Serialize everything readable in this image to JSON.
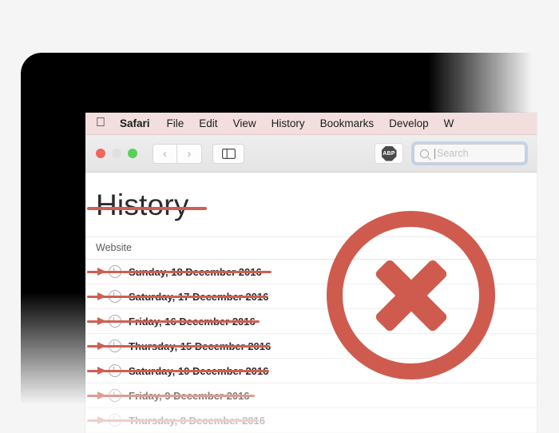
{
  "app": {
    "name": "Safari",
    "apple_logo_icon": "apple-logo-icon",
    "menus": [
      "Safari",
      "File",
      "Edit",
      "View",
      "History",
      "Bookmarks",
      "Develop",
      "W"
    ]
  },
  "toolbar": {
    "close_label": "",
    "minimize_label": "",
    "zoom_label": "",
    "back_icon": "‹",
    "forward_icon": "›",
    "sidebar_icon": "sidebar-toggle-icon",
    "extension_label": "ABP",
    "search": {
      "placeholder": "Search",
      "value": ""
    }
  },
  "page": {
    "title": "History",
    "struck_through": true,
    "columns": [
      "Website"
    ],
    "rows": [
      {
        "label": "Sunday, 18 December 2016",
        "struck": true,
        "fade": "none"
      },
      {
        "label": "Saturday, 17 December 2016",
        "struck": true,
        "fade": "none"
      },
      {
        "label": "Friday, 16 December 2016",
        "struck": true,
        "fade": "none"
      },
      {
        "label": "Thursday, 15 December 2016",
        "struck": true,
        "fade": "none"
      },
      {
        "label": "Saturday, 10 December 2016",
        "struck": true,
        "fade": "none"
      },
      {
        "label": "Friday, 9 December 2016",
        "struck": true,
        "fade": "f1"
      },
      {
        "label": "Thursday, 8 December 2016",
        "struck": true,
        "fade": "f2"
      }
    ]
  },
  "overlay": {
    "icon": "circle-x-icon",
    "meaning": "clear-history"
  },
  "colors": {
    "accent_red": "#cf5b4f",
    "menubar_pink": "#f3dede",
    "page_background": "#f5f5f5",
    "window_background": "#ffffff",
    "bezel": "#000000",
    "traffic_red": "#f1655c",
    "traffic_yellow": "#e0e0e0",
    "traffic_green": "#5ad05a"
  }
}
